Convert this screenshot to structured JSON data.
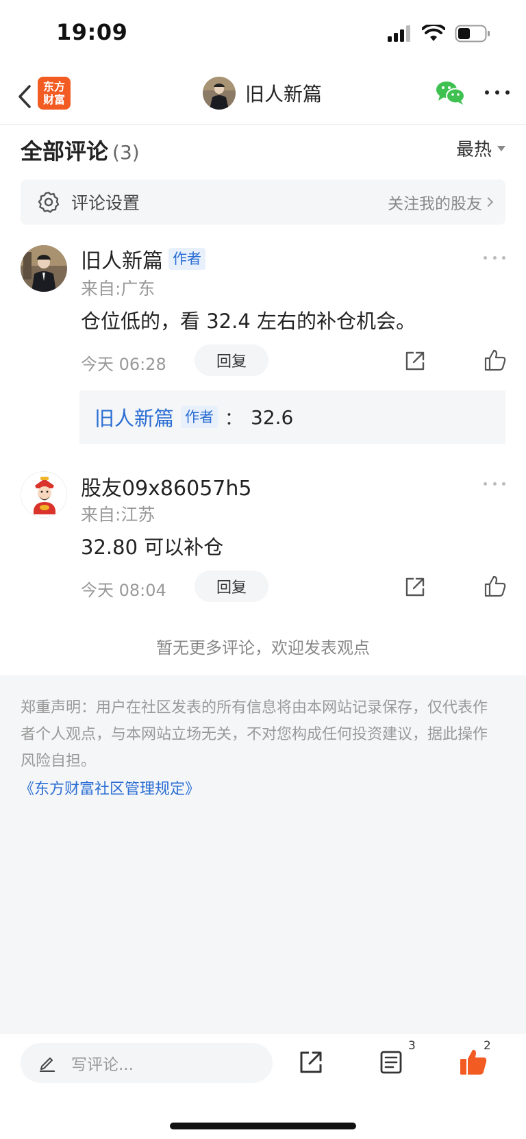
{
  "status_bar": {
    "time": "19:09"
  },
  "nav": {
    "logo_line1": "东方",
    "logo_line2": "财富",
    "title": "旧人新篇"
  },
  "comments_header": {
    "title": "全部评论",
    "count": "(3)",
    "sort": "最热"
  },
  "settings": {
    "label": "评论设置",
    "link": "关注我的股友"
  },
  "comments": [
    {
      "name": "旧人新篇",
      "badge": "作者",
      "location": "来自:广东",
      "text": "仓位低的，看 32.4 左右的补仓机会。",
      "time": "今天 06:28",
      "reply_label": "回复",
      "sub_reply": {
        "name": "旧人新篇",
        "badge": "作者",
        "colon": "：",
        "text": "32.6"
      }
    },
    {
      "name": "股友09x86057h5",
      "location": "来自:江苏",
      "text": "32.80 可以补仓",
      "time": "今天 08:04",
      "reply_label": "回复"
    }
  ],
  "no_more_text": "暂无更多评论，欢迎发表观点",
  "disclaimer": {
    "text": "郑重声明：用户在社区发表的所有信息将由本网站记录保存，仅代表作者个人观点，与本网站立场无关，不对您构成任何投资建议，据此操作风险自担。",
    "link": "《东方财富社区管理规定》"
  },
  "bottom_bar": {
    "placeholder": "写评论...",
    "comment_count": "3",
    "like_count": "2"
  },
  "colors": {
    "brand_orange": "#f25b22",
    "link_blue": "#2b6ed3",
    "wechat_green": "#3fc152"
  }
}
